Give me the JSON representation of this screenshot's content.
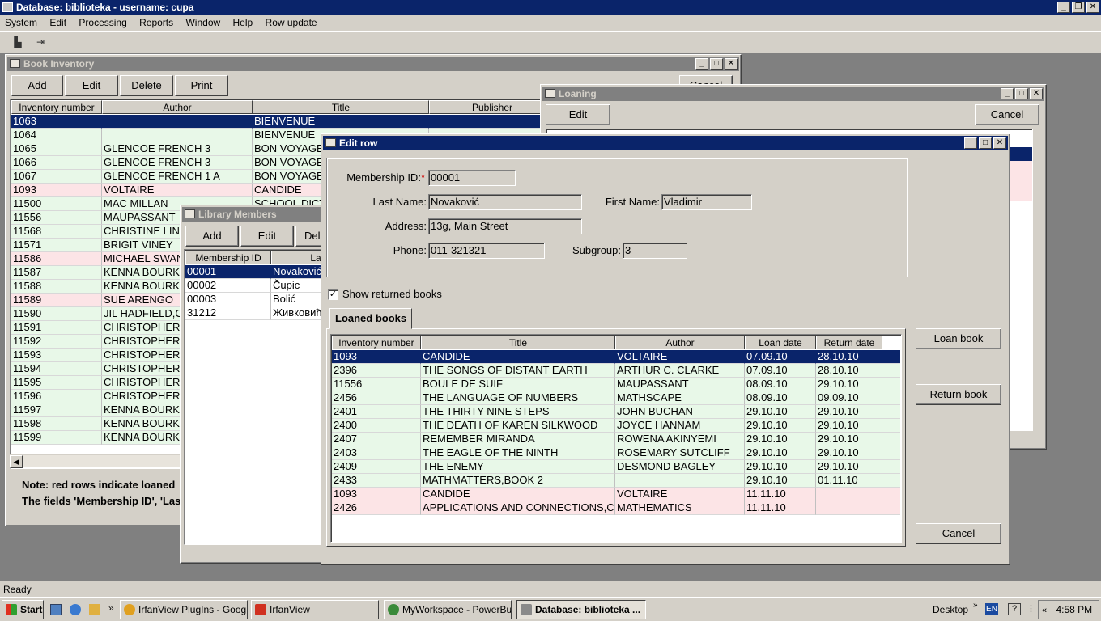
{
  "app": {
    "title": "Database: biblioteka  - username: cupa",
    "menu": [
      "System",
      "Edit",
      "Processing",
      "Reports",
      "Window",
      "Help",
      "Row update"
    ],
    "status": "Ready"
  },
  "book_inventory": {
    "title": "Book Inventory",
    "buttons": {
      "add": "Add",
      "edit": "Edit",
      "delete": "Delete",
      "print": "Print",
      "cancel": "Cancel"
    },
    "columns": [
      "Inventory number",
      "Author",
      "Title",
      "Publisher"
    ],
    "rows": [
      {
        "inv": "1063",
        "author": "",
        "title": "BIENVENUE",
        "pub": "",
        "state": "selected"
      },
      {
        "inv": "1064",
        "author": "",
        "title": "BIENVENUE",
        "pub": "",
        "state": "green"
      },
      {
        "inv": "1065",
        "author": "GLENCOE FRENCH 3",
        "title": "BON VOYAGE",
        "pub": "",
        "state": "green"
      },
      {
        "inv": "1066",
        "author": "GLENCOE FRENCH 3",
        "title": "BON VOYAGE",
        "pub": "",
        "state": "green"
      },
      {
        "inv": "1067",
        "author": "GLENCOE FRENCH 1 A",
        "title": "BON VOYAGE",
        "pub": "",
        "state": "green"
      },
      {
        "inv": "1093",
        "author": "VOLTAIRE",
        "title": "CANDIDE",
        "pub": "",
        "state": "red"
      },
      {
        "inv": "11500",
        "author": "MAC MILLAN",
        "title": "SCHOOL DICT",
        "pub": "",
        "state": "green"
      },
      {
        "inv": "11556",
        "author": "MAUPASSANT",
        "title": "",
        "pub": "",
        "state": "green"
      },
      {
        "inv": "11568",
        "author": "CHRISTINE LIND",
        "title": "",
        "pub": "",
        "state": "green"
      },
      {
        "inv": "11571",
        "author": "BRIGIT VINEY",
        "title": "",
        "pub": "",
        "state": "green"
      },
      {
        "inv": "11586",
        "author": "MICHAEL SWAN",
        "title": "",
        "pub": "",
        "state": "red"
      },
      {
        "inv": "11587",
        "author": "KENNA BOURK",
        "title": "",
        "pub": "",
        "state": "green"
      },
      {
        "inv": "11588",
        "author": "KENNA BOURK",
        "title": "",
        "pub": "",
        "state": "green"
      },
      {
        "inv": "11589",
        "author": "SUE ARENGO",
        "title": "",
        "pub": "",
        "state": "red"
      },
      {
        "inv": "11590",
        "author": "JIL HADFIELD,C",
        "title": "",
        "pub": "",
        "state": "green"
      },
      {
        "inv": "11591",
        "author": "CHRISTOPHER",
        "title": "",
        "pub": "",
        "state": "green"
      },
      {
        "inv": "11592",
        "author": "CHRISTOPHER",
        "title": "",
        "pub": "",
        "state": "green"
      },
      {
        "inv": "11593",
        "author": "CHRISTOPHER",
        "title": "",
        "pub": "",
        "state": "green"
      },
      {
        "inv": "11594",
        "author": "CHRISTOPHER",
        "title": "",
        "pub": "",
        "state": "green"
      },
      {
        "inv": "11595",
        "author": "CHRISTOPHER",
        "title": "",
        "pub": "",
        "state": "green"
      },
      {
        "inv": "11596",
        "author": "CHRISTOPHER",
        "title": "",
        "pub": "",
        "state": "green"
      },
      {
        "inv": "11597",
        "author": "KENNA BOURK",
        "title": "",
        "pub": "",
        "state": "green"
      },
      {
        "inv": "11598",
        "author": "KENNA BOURK",
        "title": "",
        "pub": "",
        "state": "green"
      },
      {
        "inv": "11599",
        "author": "KENNA BOURK",
        "title": "",
        "pub": "",
        "state": "green"
      }
    ],
    "note1": "Note: red rows indicate loaned",
    "note2": "The fields 'Membership ID', 'Las"
  },
  "library_members": {
    "title": "Library Members",
    "buttons": {
      "add": "Add",
      "edit": "Edit",
      "delete": "Del"
    },
    "columns": [
      "Membership ID",
      "La"
    ],
    "rows": [
      {
        "id": "00001",
        "last": "Novaković",
        "state": "selected"
      },
      {
        "id": "00002",
        "last": "Čupic",
        "state": "white"
      },
      {
        "id": "00003",
        "last": "Bolić",
        "state": "white"
      },
      {
        "id": "31212",
        "last": "Живковић",
        "state": "white"
      }
    ]
  },
  "loaning": {
    "title": "Loaning",
    "edit": "Edit",
    "cancel": "Cancel"
  },
  "edit_row": {
    "title": "Edit row",
    "fields": {
      "membership_id_label": "Membership ID:",
      "required_mark": "*",
      "membership_id": "00001",
      "last_name_label": "Last Name:",
      "last_name": "Novaković",
      "first_name_label": "First Name:",
      "first_name": "Vladimir",
      "address_label": "Address:",
      "address": "13g, Main Street",
      "phone_label": "Phone:",
      "phone": "011-321321",
      "subgroup_label": "Subgroup:",
      "subgroup": "3"
    },
    "show_returned_label": "Show returned books",
    "show_returned_checked": "✓",
    "tab_label": "Loaned books",
    "columns": [
      "Inventory number",
      "Title",
      "Author",
      "Loan date",
      "Return date"
    ],
    "rows": [
      {
        "inv": "1093",
        "title": "CANDIDE",
        "author": "VOLTAIRE",
        "loan": "07.09.10",
        "ret": "28.10.10",
        "state": "selected"
      },
      {
        "inv": "2396",
        "title": "THE SONGS OF DISTANT EARTH",
        "author": "ARTHUR C. CLARKE",
        "loan": "07.09.10",
        "ret": "28.10.10",
        "state": "green"
      },
      {
        "inv": "11556",
        "title": "BOULE DE SUIF",
        "author": "MAUPASSANT",
        "loan": "08.09.10",
        "ret": "29.10.10",
        "state": "green"
      },
      {
        "inv": "2456",
        "title": "THE LANGUAGE OF NUMBERS",
        "author": "MATHSCAPE",
        "loan": "08.09.10",
        "ret": "09.09.10",
        "state": "green"
      },
      {
        "inv": "2401",
        "title": "THE THIRTY-NINE STEPS",
        "author": "JOHN BUCHAN",
        "loan": "29.10.10",
        "ret": "29.10.10",
        "state": "green"
      },
      {
        "inv": "2400",
        "title": "THE DEATH OF KAREN SILKWOOD",
        "author": "JOYCE HANNAM",
        "loan": "29.10.10",
        "ret": "29.10.10",
        "state": "green"
      },
      {
        "inv": "2407",
        "title": "REMEMBER MIRANDA",
        "author": "ROWENA AKINYEMI",
        "loan": "29.10.10",
        "ret": "29.10.10",
        "state": "green"
      },
      {
        "inv": "2403",
        "title": "THE EAGLE OF THE NINTH",
        "author": "ROSEMARY SUTCLIFF",
        "loan": "29.10.10",
        "ret": "29.10.10",
        "state": "green"
      },
      {
        "inv": "2409",
        "title": "THE ENEMY",
        "author": "DESMOND BAGLEY",
        "loan": "29.10.10",
        "ret": "29.10.10",
        "state": "green"
      },
      {
        "inv": "2433",
        "title": "MATHMATTERS,BOOK 2",
        "author": "",
        "loan": "29.10.10",
        "ret": "01.11.10",
        "state": "green"
      },
      {
        "inv": "1093",
        "title": "CANDIDE",
        "author": "VOLTAIRE",
        "loan": "11.11.10",
        "ret": "",
        "state": "red"
      },
      {
        "inv": "2426",
        "title": "APPLICATIONS AND CONNECTIONS,CO",
        "author": "MATHEMATICS",
        "loan": "11.11.10",
        "ret": "",
        "state": "red"
      }
    ],
    "loan_book": "Loan book",
    "return_book": "Return book",
    "cancel": "Cancel"
  },
  "taskbar": {
    "start": "Start",
    "items": [
      {
        "label": "IrfanView PlugIns - Goog...",
        "color": "#e0a020",
        "state": "normal"
      },
      {
        "label": "IrfanView",
        "color": "#d03020",
        "state": "normal"
      },
      {
        "label": "MyWorkspace - PowerBu...",
        "color": "#3a8a3a",
        "state": "normal"
      },
      {
        "label": "Database: biblioteka ...",
        "color": "#8a8a8a",
        "state": "pressed"
      }
    ],
    "desktop": "Desktop",
    "lang": "EN",
    "time": "4:58 PM"
  },
  "colors": {
    "title_active": "#0a246a",
    "row_green": "#e8f8e8",
    "row_red": "#fce4e6",
    "face": "#d4d0c8"
  }
}
